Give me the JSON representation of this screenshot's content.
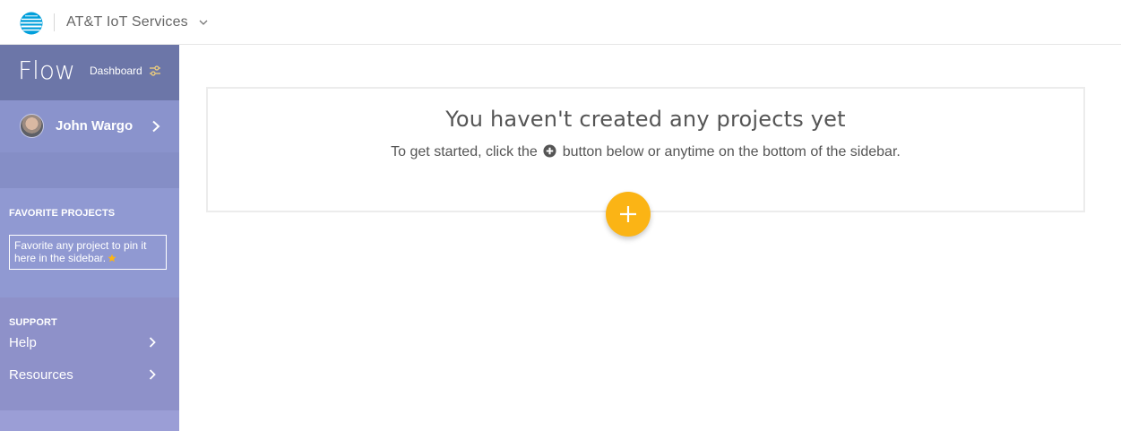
{
  "topbar": {
    "app_name": "AT&T IoT Services",
    "logo_icon": "att-globe-icon",
    "switcher_icon": "chevron-down-icon"
  },
  "sidebar": {
    "brand": "Flow",
    "dashboard_label": "Dashboard",
    "dashboard_icon": "sliders-icon",
    "user_name": "John Wargo",
    "favorites": {
      "title": "FAVORITE PROJECTS",
      "hint": "Favorite any project to pin it here in the sidebar."
    },
    "support": {
      "title": "SUPPORT",
      "links": [
        {
          "label": "Help"
        },
        {
          "label": "Resources"
        }
      ]
    }
  },
  "main": {
    "empty_title": "You haven't created any projects yet",
    "empty_sub_before": "To get started, click the",
    "empty_sub_after": "button below or anytime on the bottom of the sidebar."
  },
  "colors": {
    "sidebar_header": "#6c76a8",
    "sidebar": "#8e96cf",
    "fab": "#fbb415",
    "att_blue": "#009fdb"
  }
}
